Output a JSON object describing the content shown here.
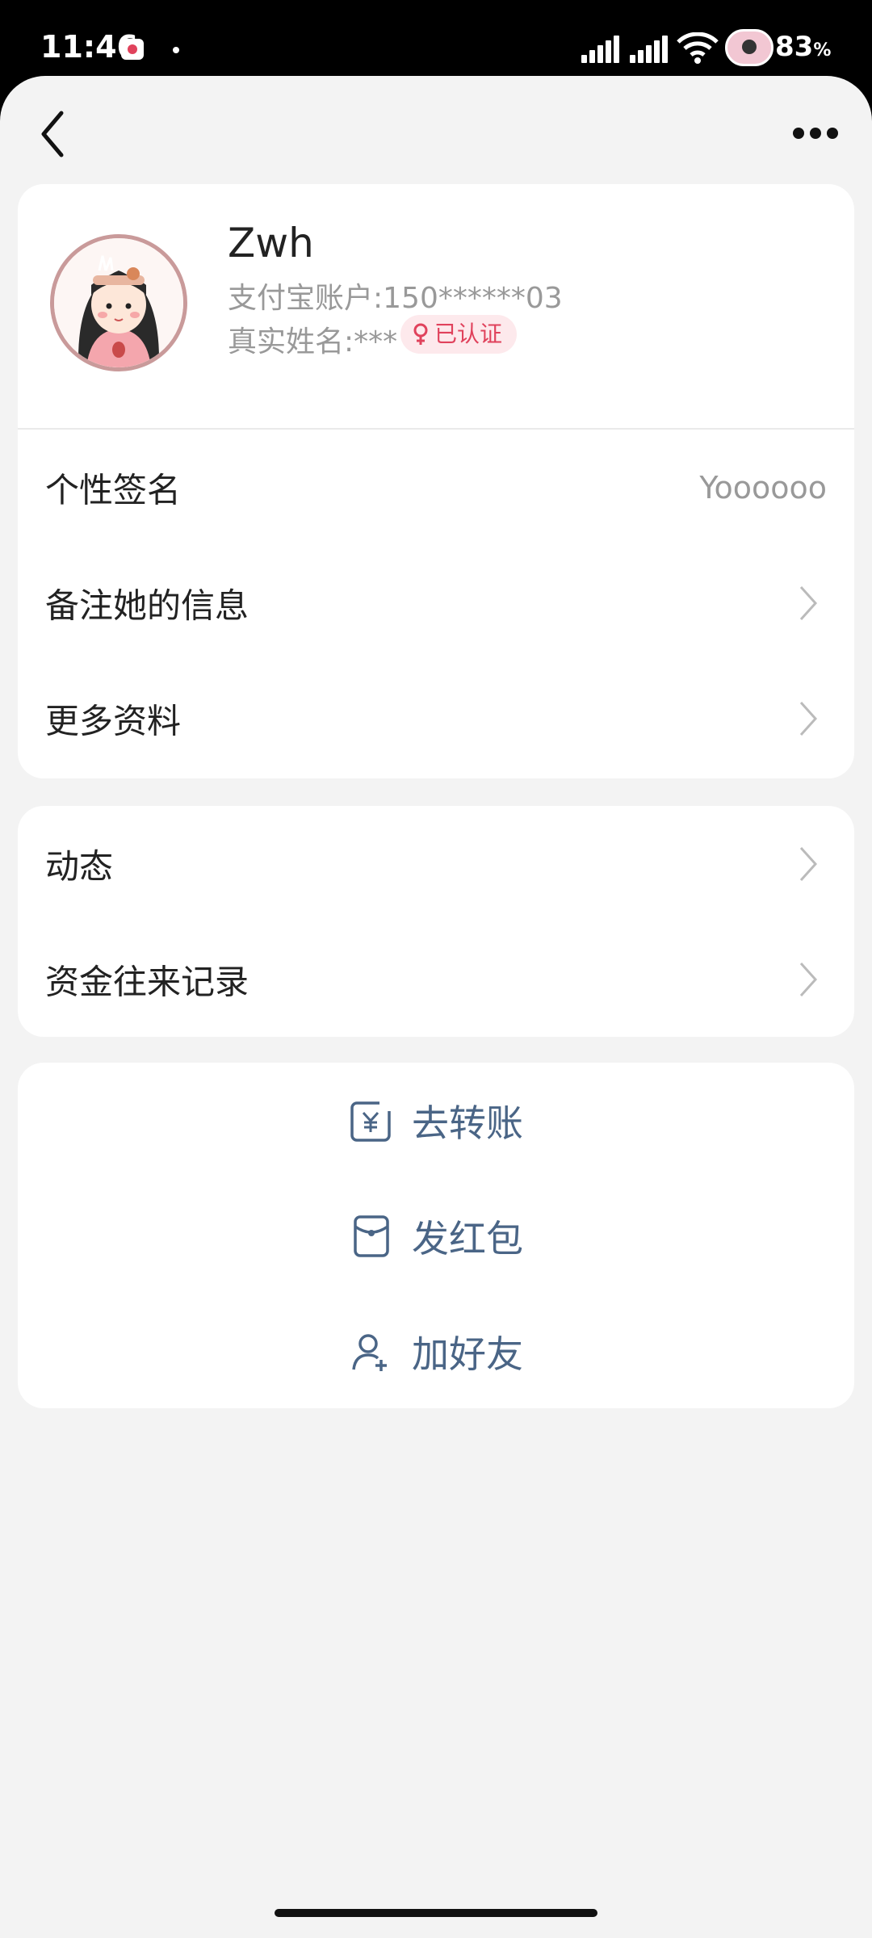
{
  "status_bar": {
    "time": "11:46",
    "battery": "83",
    "battery_unit": "%"
  },
  "profile": {
    "name": "Zwh",
    "account": "支付宝账户:150******03",
    "real_name": "真实姓名:***",
    "verified_label": "已认证"
  },
  "info_rows": [
    {
      "label": "个性签名",
      "value": "Yoooooo"
    },
    {
      "label": "备注她的信息"
    },
    {
      "label": "更多资料"
    }
  ],
  "activity_rows": [
    {
      "label": "动态"
    },
    {
      "label": "资金往来记录"
    }
  ],
  "actions": [
    {
      "label": "去转账",
      "icon": "transfer-icon"
    },
    {
      "label": "发红包",
      "icon": "red-packet-icon"
    },
    {
      "label": "加好友",
      "icon": "add-friend-icon"
    }
  ],
  "colors": {
    "action_blue": "#4a6586",
    "verified_red": "#e0425c",
    "background": "#f3f3f3"
  }
}
